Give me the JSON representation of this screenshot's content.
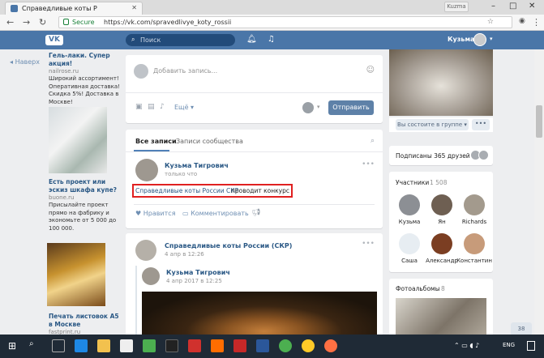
{
  "browser": {
    "tab_title": "Справедливые коты Р",
    "secure_label": "Secure",
    "url": "https://vk.com/spravedlivye_koty_rossii",
    "user_chip": "Kuzma"
  },
  "header": {
    "logo": "VK",
    "search_placeholder": "Поиск",
    "user_name": "Кузьма"
  },
  "left": {
    "back_label": "Наверх",
    "ads": [
      {
        "title": "Гель-лаки. Супер акция!",
        "host": "nailrose.ru",
        "text": "Широкий ассортимент! Оперативная доставка! Скидка 5%! Доставка в Москве!"
      },
      {
        "title": "Есть проект или эскиз шкафа купе?",
        "host": "buone.ru",
        "text": "Присылайте проект прямо на фабрику и экономьте от 5 000 до 100 000."
      },
      {
        "title": "Печать листовок А5 в Москве",
        "host": "fastprint.ru",
        "text": ""
      }
    ]
  },
  "compose": {
    "placeholder": "Добавить запись...",
    "more_label": "Ещё",
    "send_label": "Отправить"
  },
  "wall": {
    "tab_all": "Все записи",
    "tab_community": "Записи сообщества",
    "post1": {
      "author": "Кузьма Тигрович",
      "time": "только что",
      "link_text": "Справедливые коты России СКР",
      "text": "проводит конкурс",
      "like_label": "Нравится",
      "comment_label": "Комментировать"
    },
    "post2": {
      "author": "Справедливые коты России (СКР)",
      "time": "4 апр в 12:26",
      "repost_author": "Кузьма Тигрович",
      "repost_time": "4 апр 2017 в 12:25"
    }
  },
  "right": {
    "join_label": "Вы состоите в группе",
    "more_label": "•••",
    "subscribed_label": "Подписаны 365 друзей",
    "members_label": "Участники",
    "members_count": "1 508",
    "members": [
      {
        "name": "Кузьма"
      },
      {
        "name": "Ян"
      },
      {
        "name": "Richards"
      },
      {
        "name": "Саша"
      },
      {
        "name": "Александр"
      },
      {
        "name": "Константин"
      }
    ],
    "albums_label": "Фотоальбомы",
    "albums_count": "8",
    "up_count": "38"
  },
  "taskbar": {
    "lang": "ENG"
  },
  "colors": {
    "vk_blue": "#4a76a8",
    "link": "#2a5885",
    "highlight_red": "#e02020"
  }
}
